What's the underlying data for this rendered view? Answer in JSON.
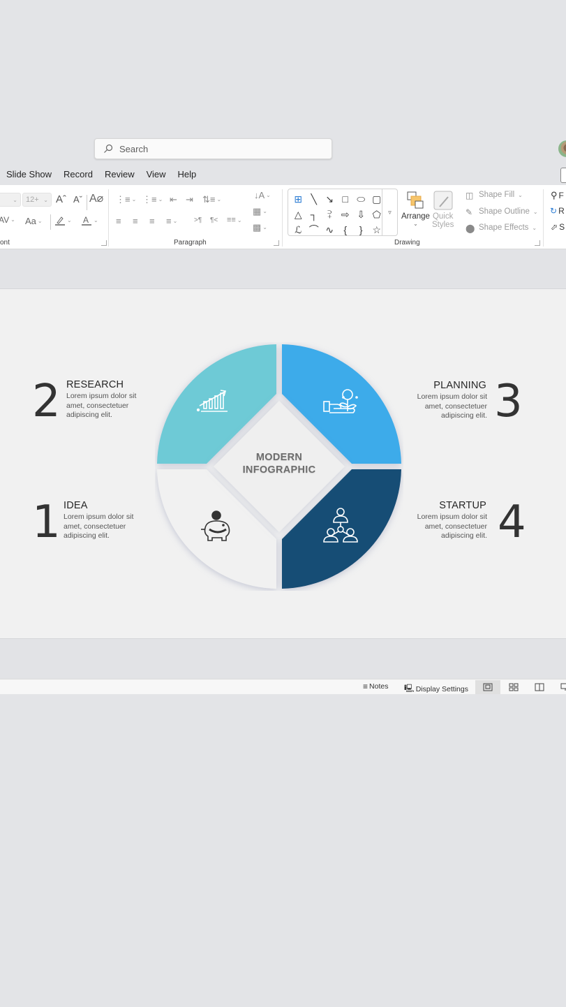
{
  "titlebar": {
    "search_placeholder": "Search",
    "search_icon": "search-icon",
    "account_icon": "user-avatar"
  },
  "menu_tabs": [
    "Slide Show",
    "Record",
    "Review",
    "View",
    "Help"
  ],
  "ribbon": {
    "font": {
      "label": "Font",
      "label_visible": "ont",
      "font_name_value": "",
      "font_size_value": "12+",
      "buttons": [
        "increase-font-size",
        "decrease-font-size",
        "clear-formatting",
        "character-spacing",
        "change-case",
        "highlight-color",
        "font-color"
      ],
      "increase_glyph": "Aˆ",
      "decrease_glyph": "Aˇ",
      "change_case_glyph": "Aa",
      "char_spacing_glyph": "AV"
    },
    "paragraph": {
      "label": "Paragraph",
      "buttons": [
        "bullets",
        "numbering",
        "decrease-indent",
        "increase-indent",
        "line-spacing",
        "align-left",
        "center",
        "align-right",
        "justify",
        "ltr",
        "rtl",
        "columns",
        "text-direction",
        "align-text",
        "convert-to-smartart"
      ]
    },
    "drawing": {
      "label": "Drawing",
      "shapes": [
        "⊞",
        "╲",
        "↘",
        "□",
        "⬭",
        "▢",
        "△",
        "┐",
        "⫀",
        "⇨",
        "⇩",
        "⬠",
        "ℒ",
        "⌒",
        "∿",
        "{",
        "}",
        "☆"
      ],
      "arrange_label": "Arrange",
      "quick_styles_label_1": "Quick",
      "quick_styles_label_2": "Styles",
      "shape_fill": "Shape Fill",
      "shape_outline": "Shape Outline",
      "shape_effects": "Shape Effects"
    },
    "editing": {
      "items": [
        "F",
        "R",
        "S"
      ],
      "icons": [
        "find-icon",
        "replace-icon",
        "select-icon"
      ]
    }
  },
  "slide": {
    "center_title_line1": "MODERN",
    "center_title_line2": "INFOGRAPHIC",
    "steps": [
      {
        "number": "1",
        "title": "IDEA",
        "desc": "Lorem ipsum dolor sit amet, consectetuer adipiscing elit.",
        "color": "#f1f1f1",
        "icon": "piggy-bank-icon"
      },
      {
        "number": "2",
        "title": "RESEARCH",
        "desc": "Lorem ipsum dolor sit amet, consectetuer adipiscing elit.",
        "color": "#6ecad6",
        "icon": "growth-chart-icon"
      },
      {
        "number": "3",
        "title": "PLANNING",
        "desc": "Lorem ipsum dolor sit amet, consectetuer adipiscing elit.",
        "color": "#3dabea",
        "icon": "hand-plant-icon"
      },
      {
        "number": "4",
        "title": "STARTUP",
        "desc": "Lorem ipsum dolor sit amet, consectetuer adipiscing elit.",
        "color": "#154d74",
        "icon": "team-hierarchy-icon"
      }
    ]
  },
  "statusbar": {
    "notes_label": "Notes",
    "display_settings_label": "Display Settings",
    "views": [
      "normal",
      "slide-sorter",
      "reading-view",
      "slide-show"
    ],
    "active_view": "normal"
  }
}
